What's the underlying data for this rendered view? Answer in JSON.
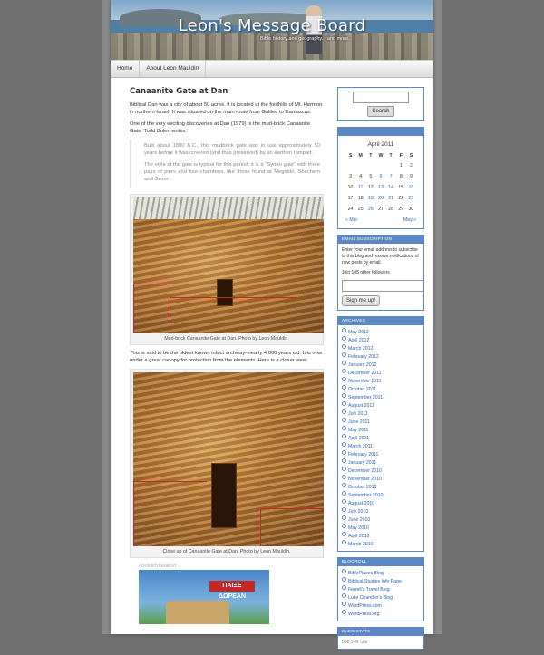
{
  "site": {
    "title": "Leon's Message Board",
    "description": "Bible history and geography... and more."
  },
  "nav": {
    "items": [
      {
        "label": "Home"
      },
      {
        "label": "About Leon Mauldin"
      }
    ]
  },
  "post": {
    "title": "Canaanite Gate at Dan",
    "p1": "Biblical Dan was a city of about 50 acres. It is located at the foothills of Mt. Hermon in northern Israel. It was situated on the main route from Galilee to Damascus.",
    "p2": "One of the very exciting discoveries at Dan (1979)  is the mud-brick Canaanite Gate. Todd Bolen writes:",
    "quote1": "Built about 1800 B.C., this mudbrick gate was in use approximately 50 years before it was covered (and thus preserved) by an earthen rampart.",
    "quote2": "The style of the gate is typical for this period; it is a \"Syrian gate\" with three pairs of piers and four chambers, like those found at Megiddo, Shechem and Gezer.",
    "caption1": "Mud-brick Canaanite Gate at Dan. Photo by Leon Mauldin.",
    "p3": "This is said to be the oldest known intact archway–nearly 4,000 years old. It is now under a great canopy for protection from the elements. Here is a closer view:",
    "caption2": "Close up of Canaanite Gate at Dan. Photo by Leon Mauldin.",
    "ad_label": "ADVERTISEMENT",
    "ad_text": "ΠΑΙΞΕ ΔΩΡΕΑΝ"
  },
  "sidebar": {
    "search": {
      "button": "Search",
      "placeholder": ""
    },
    "calendar": {
      "caption": "April 2011",
      "days": [
        "S",
        "M",
        "T",
        "W",
        "T",
        "F",
        "S"
      ],
      "weeks": [
        [
          "",
          "",
          "",
          "",
          "",
          "1",
          "2"
        ],
        [
          "3",
          "4",
          "5",
          "6",
          "7",
          "8",
          "9"
        ],
        [
          "10",
          "11",
          "12",
          "13",
          "14",
          "15",
          "16"
        ],
        [
          "17",
          "18",
          "19",
          "20",
          "21",
          "22",
          "23"
        ],
        [
          "24",
          "25",
          "26",
          "27",
          "28",
          "29",
          "30"
        ]
      ],
      "linked": [
        "2",
        "6",
        "7",
        "11",
        "13",
        "14",
        "16",
        "19",
        "20",
        "21",
        "23",
        "26"
      ],
      "prev": "« Mar",
      "next": "May »"
    },
    "subscription": {
      "title": "EMAIL SUBSCRIPTION",
      "text": "Enter your email address to subscribe to this blog and receive notifications of new posts by email.",
      "followers": "Join 105 other followers",
      "button": "Sign me up!"
    },
    "archives": {
      "title": "ARCHIVES",
      "items": [
        "May 2012",
        "April 2012",
        "March 2012",
        "February 2012",
        "January 2012",
        "December 2011",
        "November 2011",
        "October 2011",
        "September 2011",
        "August 2011",
        "July 2011",
        "June 2011",
        "May 2011",
        "April 2011",
        "March 2011",
        "February 2011",
        "January 2011",
        "December 2010",
        "November 2010",
        "October 2010",
        "September 2010",
        "August 2010",
        "July 2010",
        "June 2010",
        "May 2010",
        "April 2010",
        "March 2010"
      ]
    },
    "blogroll": {
      "title": "BLOGROLL",
      "items": [
        "BiblePlaces Blog",
        "Biblical Studies Info Page",
        "Ferrell's Travel Blog",
        "Luke Chandler's Blog",
        "WordPress.com",
        "WordPress.org"
      ]
    },
    "stats": {
      "title": "BLOG STATS",
      "value": "338,241 hits"
    }
  }
}
